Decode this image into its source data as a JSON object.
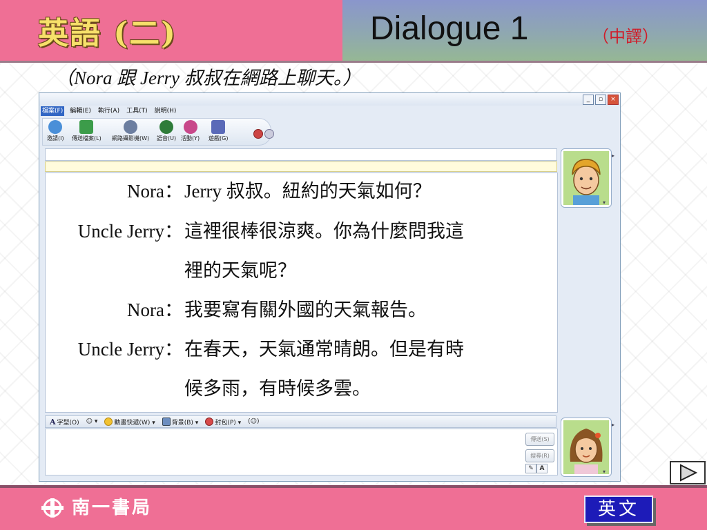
{
  "header": {
    "subject_title": "英語 (二)",
    "dialogue_title": "Dialogue 1",
    "translation_tag": "（中譯）",
    "subtitle": "（Nora 跟 Jerry 叔叔在網路上聊天。）"
  },
  "window": {
    "title_buttons": [
      "_",
      "▫",
      "×"
    ],
    "menu": [
      "檔案(F)",
      "編輯(E)",
      "執行(A)",
      "工具(T)",
      "說明(H)"
    ],
    "toolbar": [
      {
        "label": "邀請(I)",
        "icon": "invite-icon",
        "color": "#4a8fd8"
      },
      {
        "label": "傳送檔案(L)",
        "icon": "send-file-icon",
        "color": "#3c9c4a"
      },
      {
        "label": "網路攝影機(W)",
        "icon": "webcam-icon",
        "color": "#6c7ea0"
      },
      {
        "label": "語音(U)",
        "icon": "voice-icon",
        "color": "#2f7c3a"
      },
      {
        "label": "活動(Y)",
        "icon": "activities-icon",
        "color": "#c8488a"
      },
      {
        "label": "遊戲(G)",
        "icon": "games-icon",
        "color": "#5a6ab8"
      }
    ],
    "format_bar": [
      "字型(O)",
      "☺ ▾",
      "動畫快遞(W) ▾",
      "背景(B) ▾",
      "封包(P) ▾",
      "(☺)"
    ],
    "send_label": "傳送(S)",
    "search_label": "搜尋(R)"
  },
  "dialogue": [
    {
      "speaker": "Nora：",
      "text": "Jerry 叔叔。紐約的天氣如何？"
    },
    {
      "speaker": "Uncle Jerry：",
      "text": "這裡很棒很涼爽。你為什麼問我這"
    },
    {
      "speaker": "",
      "text": "裡的天氣呢？"
    },
    {
      "speaker": "Nora：",
      "text": "我要寫有關外國的天氣報告。"
    },
    {
      "speaker": "Uncle Jerry：",
      "text": "在春天，天氣通常晴朗。但是有時"
    },
    {
      "speaker": "",
      "text": "候多雨，有時候多雲。"
    }
  ],
  "footer": {
    "publisher": "南一書局",
    "english_button": "英文"
  },
  "colors": {
    "header_pink": "#ef6f95",
    "chinese_accent_red": "#d01d2a",
    "english_button_blue": "#1d1bb8"
  }
}
